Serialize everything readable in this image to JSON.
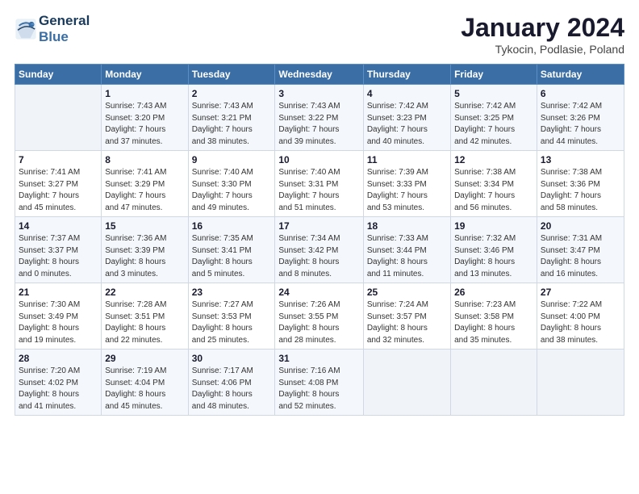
{
  "logo": {
    "line1": "General",
    "line2": "Blue"
  },
  "title": "January 2024",
  "subtitle": "Tykocin, Podlasie, Poland",
  "days_header": [
    "Sunday",
    "Monday",
    "Tuesday",
    "Wednesday",
    "Thursday",
    "Friday",
    "Saturday"
  ],
  "weeks": [
    [
      {
        "day": "",
        "info": ""
      },
      {
        "day": "1",
        "info": "Sunrise: 7:43 AM\nSunset: 3:20 PM\nDaylight: 7 hours\nand 37 minutes."
      },
      {
        "day": "2",
        "info": "Sunrise: 7:43 AM\nSunset: 3:21 PM\nDaylight: 7 hours\nand 38 minutes."
      },
      {
        "day": "3",
        "info": "Sunrise: 7:43 AM\nSunset: 3:22 PM\nDaylight: 7 hours\nand 39 minutes."
      },
      {
        "day": "4",
        "info": "Sunrise: 7:42 AM\nSunset: 3:23 PM\nDaylight: 7 hours\nand 40 minutes."
      },
      {
        "day": "5",
        "info": "Sunrise: 7:42 AM\nSunset: 3:25 PM\nDaylight: 7 hours\nand 42 minutes."
      },
      {
        "day": "6",
        "info": "Sunrise: 7:42 AM\nSunset: 3:26 PM\nDaylight: 7 hours\nand 44 minutes."
      }
    ],
    [
      {
        "day": "7",
        "info": "Sunrise: 7:41 AM\nSunset: 3:27 PM\nDaylight: 7 hours\nand 45 minutes."
      },
      {
        "day": "8",
        "info": "Sunrise: 7:41 AM\nSunset: 3:29 PM\nDaylight: 7 hours\nand 47 minutes."
      },
      {
        "day": "9",
        "info": "Sunrise: 7:40 AM\nSunset: 3:30 PM\nDaylight: 7 hours\nand 49 minutes."
      },
      {
        "day": "10",
        "info": "Sunrise: 7:40 AM\nSunset: 3:31 PM\nDaylight: 7 hours\nand 51 minutes."
      },
      {
        "day": "11",
        "info": "Sunrise: 7:39 AM\nSunset: 3:33 PM\nDaylight: 7 hours\nand 53 minutes."
      },
      {
        "day": "12",
        "info": "Sunrise: 7:38 AM\nSunset: 3:34 PM\nDaylight: 7 hours\nand 56 minutes."
      },
      {
        "day": "13",
        "info": "Sunrise: 7:38 AM\nSunset: 3:36 PM\nDaylight: 7 hours\nand 58 minutes."
      }
    ],
    [
      {
        "day": "14",
        "info": "Sunrise: 7:37 AM\nSunset: 3:37 PM\nDaylight: 8 hours\nand 0 minutes."
      },
      {
        "day": "15",
        "info": "Sunrise: 7:36 AM\nSunset: 3:39 PM\nDaylight: 8 hours\nand 3 minutes."
      },
      {
        "day": "16",
        "info": "Sunrise: 7:35 AM\nSunset: 3:41 PM\nDaylight: 8 hours\nand 5 minutes."
      },
      {
        "day": "17",
        "info": "Sunrise: 7:34 AM\nSunset: 3:42 PM\nDaylight: 8 hours\nand 8 minutes."
      },
      {
        "day": "18",
        "info": "Sunrise: 7:33 AM\nSunset: 3:44 PM\nDaylight: 8 hours\nand 11 minutes."
      },
      {
        "day": "19",
        "info": "Sunrise: 7:32 AM\nSunset: 3:46 PM\nDaylight: 8 hours\nand 13 minutes."
      },
      {
        "day": "20",
        "info": "Sunrise: 7:31 AM\nSunset: 3:47 PM\nDaylight: 8 hours\nand 16 minutes."
      }
    ],
    [
      {
        "day": "21",
        "info": "Sunrise: 7:30 AM\nSunset: 3:49 PM\nDaylight: 8 hours\nand 19 minutes."
      },
      {
        "day": "22",
        "info": "Sunrise: 7:28 AM\nSunset: 3:51 PM\nDaylight: 8 hours\nand 22 minutes."
      },
      {
        "day": "23",
        "info": "Sunrise: 7:27 AM\nSunset: 3:53 PM\nDaylight: 8 hours\nand 25 minutes."
      },
      {
        "day": "24",
        "info": "Sunrise: 7:26 AM\nSunset: 3:55 PM\nDaylight: 8 hours\nand 28 minutes."
      },
      {
        "day": "25",
        "info": "Sunrise: 7:24 AM\nSunset: 3:57 PM\nDaylight: 8 hours\nand 32 minutes."
      },
      {
        "day": "26",
        "info": "Sunrise: 7:23 AM\nSunset: 3:58 PM\nDaylight: 8 hours\nand 35 minutes."
      },
      {
        "day": "27",
        "info": "Sunrise: 7:22 AM\nSunset: 4:00 PM\nDaylight: 8 hours\nand 38 minutes."
      }
    ],
    [
      {
        "day": "28",
        "info": "Sunrise: 7:20 AM\nSunset: 4:02 PM\nDaylight: 8 hours\nand 41 minutes."
      },
      {
        "day": "29",
        "info": "Sunrise: 7:19 AM\nSunset: 4:04 PM\nDaylight: 8 hours\nand 45 minutes."
      },
      {
        "day": "30",
        "info": "Sunrise: 7:17 AM\nSunset: 4:06 PM\nDaylight: 8 hours\nand 48 minutes."
      },
      {
        "day": "31",
        "info": "Sunrise: 7:16 AM\nSunset: 4:08 PM\nDaylight: 8 hours\nand 52 minutes."
      },
      {
        "day": "",
        "info": ""
      },
      {
        "day": "",
        "info": ""
      },
      {
        "day": "",
        "info": ""
      }
    ]
  ]
}
